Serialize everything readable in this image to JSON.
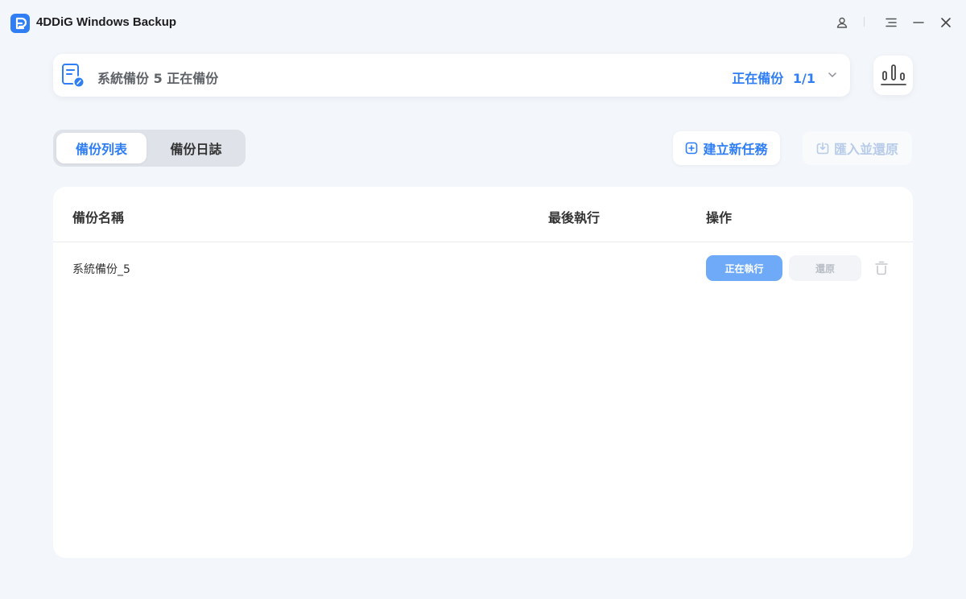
{
  "app": {
    "title": "4DDiG Windows Backup",
    "logo_icon": "4ddig-logo-icon",
    "accent_color": "#2f7ef5"
  },
  "window_controls": {
    "account_icon": "user-icon",
    "menu_icon": "menu-icon",
    "minimize_icon": "minimize-icon",
    "close_icon": "close-icon"
  },
  "status": {
    "text": "系統備份 5 正在備份",
    "progress_label": "正在備份",
    "progress_count": "1/1",
    "icon": "backup-document-icon"
  },
  "stats_button": {
    "icon": "bar-chart-icon"
  },
  "tabs": [
    {
      "label": "備份列表",
      "active": true
    },
    {
      "label": "備份日誌",
      "active": false
    }
  ],
  "actions": {
    "new_task_label": "建立新任務",
    "new_task_icon": "plus-square-icon",
    "import_label": "匯入並還原",
    "import_icon": "import-icon"
  },
  "table": {
    "columns": [
      "備份名稱",
      "最後執行",
      "操作"
    ],
    "rows": [
      {
        "name": "系統備份_5",
        "last_run": "",
        "running_label": "正在執行",
        "restore_label": "還原",
        "delete_icon": "trash-icon"
      }
    ]
  }
}
